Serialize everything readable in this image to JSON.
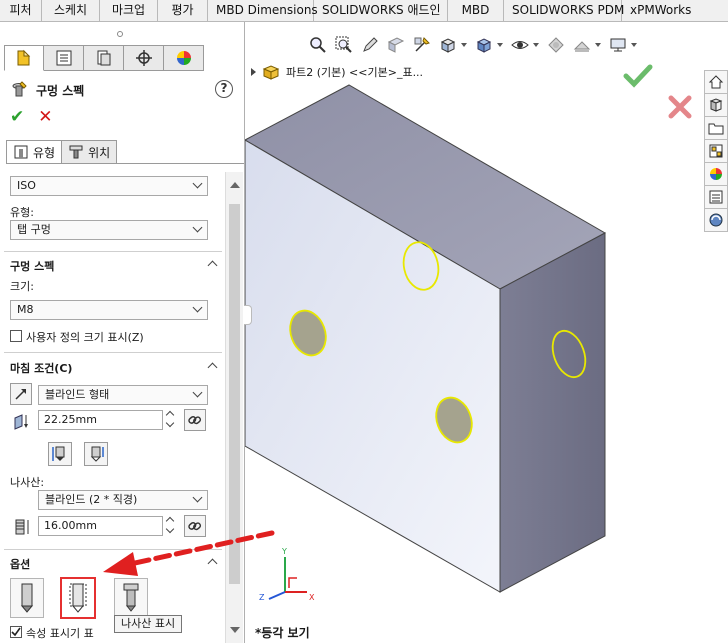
{
  "top_tabs": [
    "피처",
    "스케치",
    "마크업",
    "평가",
    "MBD Dimensions",
    "SOLIDWORKS 애드인",
    "MBD",
    "SOLIDWORKS PDM",
    "xPMWorks"
  ],
  "feature": {
    "title": "구멍 스펙",
    "help": "?",
    "ok": "✔",
    "cancel": "✕"
  },
  "sub_tabs": {
    "type": "유형",
    "position": "위치"
  },
  "fields": {
    "standard": "ISO",
    "type_label": "유형:",
    "type_value": "탭 구멍",
    "spec_header": "구멍 스펙",
    "size_label": "크기:",
    "size_value": "M8",
    "custom_size": "사용자 정의 크기 표시(Z)",
    "end_header": "마침 조건(C)",
    "end_condition": "블라인드 형태",
    "depth": "22.25mm",
    "thread_label": "나사산:",
    "thread_value": "블라인드 (2 * 직경)",
    "thread_depth": "16.00mm",
    "options_header": "옵션",
    "cosmetic_label": "속성 표시기 표"
  },
  "tooltip": "나사산 표시",
  "graphics": {
    "tree_label": "파트2 (기본) <<기본>_표...",
    "view_name": "*등각 보기",
    "colors": {
      "accept": "#3aa63a",
      "reject": "#d9535a",
      "hole_edge": "#e8e800",
      "drag_arrow": "#e02020",
      "highlight": "#e53030"
    }
  },
  "triad": {
    "y": "Y",
    "z": "Z",
    "x": "X"
  }
}
